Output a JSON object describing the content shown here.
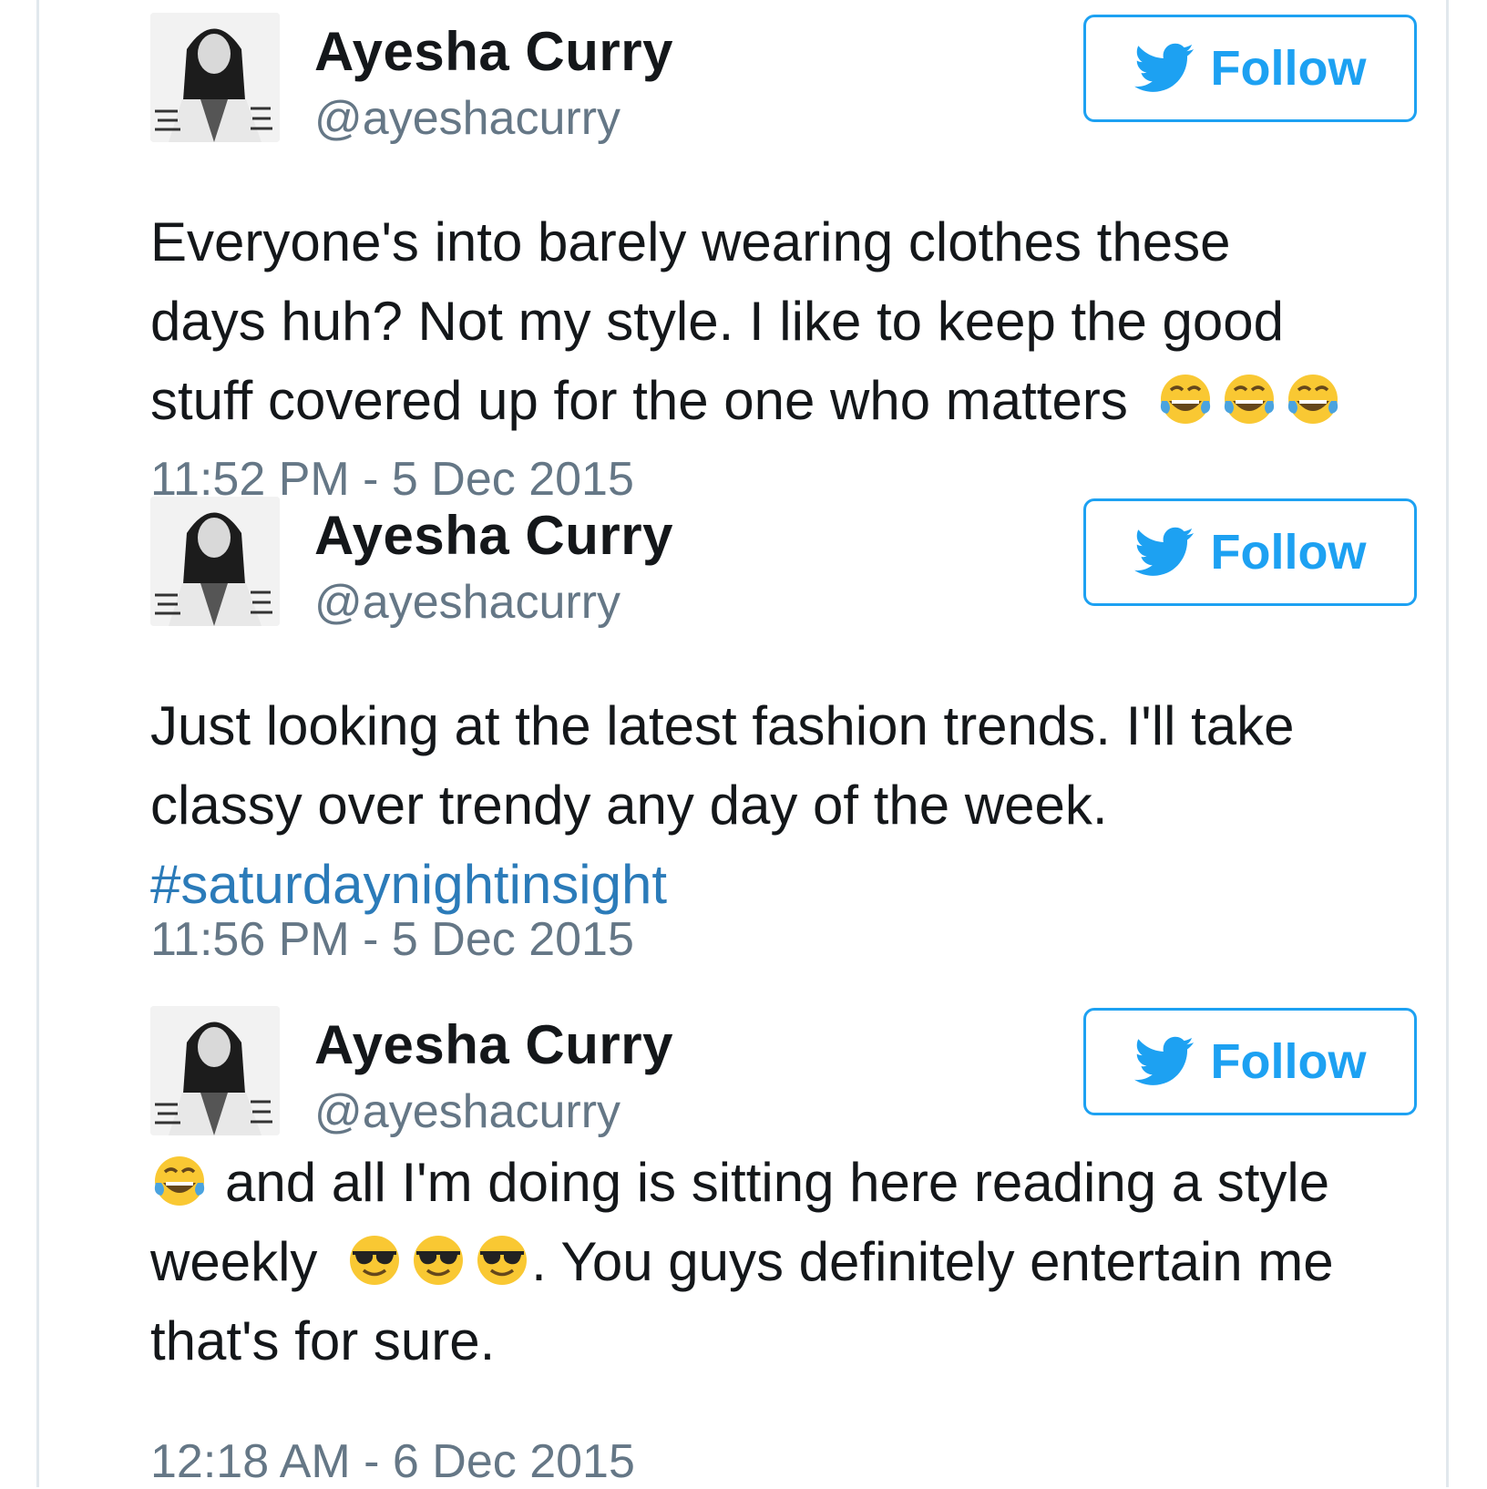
{
  "colors": {
    "accent": "#1da1f2",
    "hashtag": "#2b7bb9",
    "meta": "#657786",
    "text": "#14171a"
  },
  "tweets": [
    {
      "name": "Ayesha Curry",
      "handle": "@ayeshacurry",
      "follow_label": "Follow",
      "lines": [
        "Everyone's into barely wearing clothes these",
        "days huh? Not my style. I like to keep the good",
        "stuff covered up for the one who matters"
      ],
      "time": "11:52 PM - 5 Dec 2015",
      "emojis": [
        "face-with-tears-of-joy",
        "face-with-tears-of-joy",
        "face-with-tears-of-joy"
      ]
    },
    {
      "name": "Ayesha Curry",
      "handle": "@ayeshacurry",
      "follow_label": "Follow",
      "lines": [
        "Just looking at the latest fashion trends. I'll take",
        "classy over trendy any day of the week."
      ],
      "hashtag": "#saturdaynightinsight",
      "time": "11:56 PM - 5 Dec 2015"
    },
    {
      "name": "Ayesha Curry",
      "handle": "@ayeshacurry",
      "follow_label": "Follow",
      "line1_prefix_emoji": "face-with-tears-of-joy",
      "line1": "and all I'm doing is sitting here reading a style",
      "line2_a": "weekly",
      "line2_emojis": [
        "smiling-face-with-sunglasses",
        "smiling-face-with-sunglasses",
        "smiling-face-with-sunglasses"
      ],
      "line2_b": ". You guys definitely entertain me",
      "line3": "that's for sure.",
      "time": "12:18 AM - 6 Dec 2015"
    }
  ]
}
